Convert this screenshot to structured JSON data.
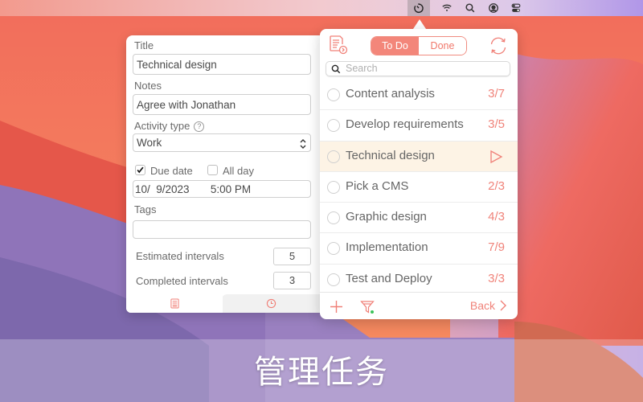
{
  "menubar": {
    "icons": [
      "timer-icon",
      "wifi-icon",
      "search-icon",
      "user-account-icon",
      "control-center-icon"
    ]
  },
  "editor": {
    "title_label": "Title",
    "title_value": "Technical design",
    "notes_label": "Notes",
    "notes_value": "Agree with Jonathan",
    "activity_label": "Activity type",
    "activity_help": "?",
    "activity_value": "Work",
    "due_date_label": "Due date",
    "due_date_checked": true,
    "all_day_label": "All day",
    "all_day_checked": false,
    "datetime_value": "10/  9/2023       5:00 PM",
    "tags_label": "Tags",
    "tags_value": "",
    "estimated_label": "Estimated intervals",
    "estimated_value": "5",
    "completed_label": "Completed intervals",
    "completed_value": "3",
    "tabs": [
      "details-tab",
      "timer-tab"
    ]
  },
  "popover": {
    "segments": {
      "todo": "To Do",
      "done": "Done",
      "selected": "To Do"
    },
    "search_placeholder": "Search",
    "tasks": [
      {
        "name": "Content analysis",
        "count": "3/7"
      },
      {
        "name": "Develop requirements",
        "count": "3/5"
      },
      {
        "name": "Technical design",
        "count": "",
        "selected": true
      },
      {
        "name": "Pick a CMS",
        "count": "2/3"
      },
      {
        "name": "Graphic design",
        "count": "4/3"
      },
      {
        "name": "Implementation",
        "count": "7/9"
      },
      {
        "name": "Test and Deploy",
        "count": "3/3"
      }
    ],
    "back_label": "Back"
  },
  "caption": "管理任务",
  "colors": {
    "accent": "#f3867a",
    "selected_row": "#fdf3e5",
    "filter_dot": "#3cc35a"
  }
}
